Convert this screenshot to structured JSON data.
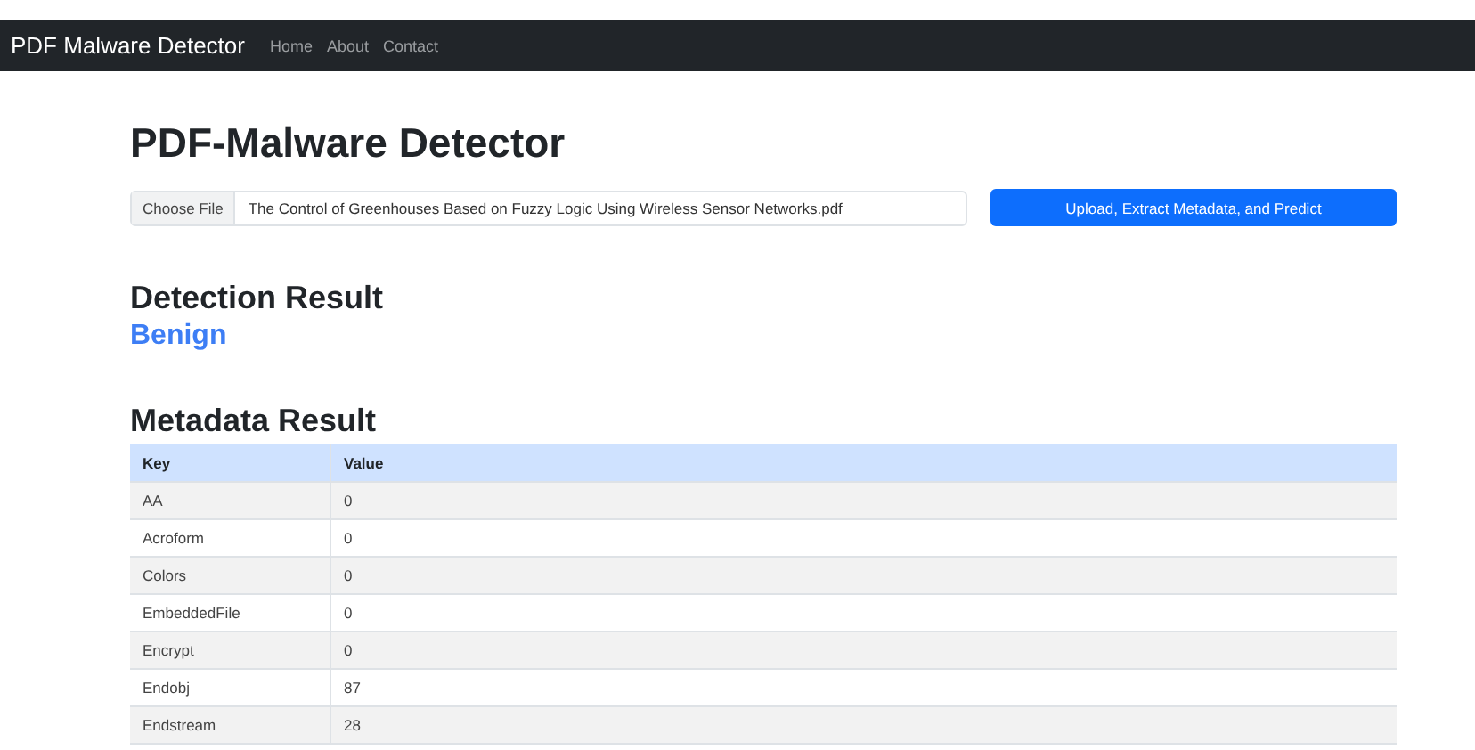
{
  "navbar": {
    "brand": "PDF Malware Detector",
    "links": [
      "Home",
      "About",
      "Contact"
    ]
  },
  "page_title": "PDF-Malware Detector",
  "file_input": {
    "button": "Choose File",
    "value": "The Control of Greenhouses Based on Fuzzy Logic Using Wireless Sensor Networks.pdf"
  },
  "submit_button": "Upload, Extract Metadata, and Predict",
  "detection": {
    "heading": "Detection Result",
    "result": "Benign"
  },
  "metadata": {
    "heading": "Metadata Result",
    "columns": [
      "Key",
      "Value"
    ],
    "rows": [
      [
        "AA",
        "0"
      ],
      [
        "Acroform",
        "0"
      ],
      [
        "Colors",
        "0"
      ],
      [
        "EmbeddedFile",
        "0"
      ],
      [
        "Encrypt",
        "0"
      ],
      [
        "Endobj",
        "87"
      ],
      [
        "Endstream",
        "28"
      ]
    ]
  }
}
